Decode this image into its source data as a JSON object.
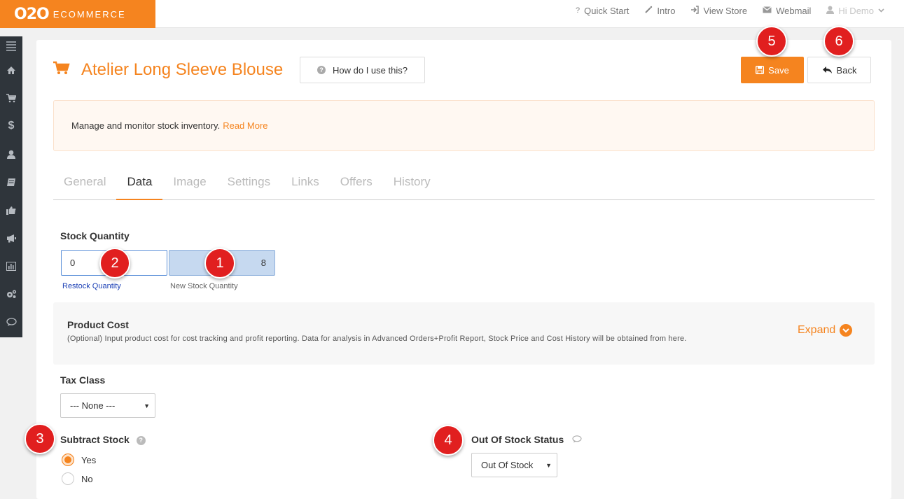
{
  "brand": {
    "mark": "O2O",
    "text": "ECOMMERCE"
  },
  "topnav": {
    "quick_start": "Quick Start",
    "intro": "Intro",
    "view_store": "View Store",
    "webmail": "Webmail",
    "user": "Hi Demo"
  },
  "sidebar": {
    "items": [
      "menu-icon",
      "home-icon",
      "cart-icon",
      "dollar-icon",
      "user-icon",
      "book-icon",
      "thumbs-up-icon",
      "megaphone-icon",
      "chart-icon",
      "gears-icon",
      "comment-icon"
    ]
  },
  "header": {
    "title": "Atelier Long Sleeve Blouse",
    "help_label": "How do I use this?",
    "save_label": "Save",
    "back_label": "Back"
  },
  "info": {
    "text": "Manage and monitor stock inventory.",
    "link": "Read More"
  },
  "tabs": [
    "General",
    "Data",
    "Image",
    "Settings",
    "Links",
    "Offers",
    "History"
  ],
  "active_tab": "Data",
  "stock": {
    "label": "Stock Quantity",
    "restock_value": "0",
    "restock_caption": "Restock Quantity",
    "new_value": "8",
    "new_caption": "New Stock Quantity"
  },
  "cost": {
    "title": "Product Cost",
    "description": "(Optional) Input product cost for cost tracking and profit reporting. Data for analysis in Advanced Orders+Profit Report, Stock Price and Cost History will be obtained from here.",
    "expand_label": "Expand"
  },
  "tax": {
    "label": "Tax Class",
    "selected": "--- None ---"
  },
  "subtract": {
    "label": "Subtract Stock",
    "options": [
      "Yes",
      "No"
    ],
    "selected": "Yes"
  },
  "out_of_stock": {
    "label": "Out Of Stock Status",
    "selected": "Out Of Stock"
  },
  "badges": [
    "1",
    "2",
    "3",
    "4",
    "5",
    "6"
  ],
  "colors": {
    "accent": "#f5841f",
    "badge": "#e11f1f",
    "sidebar": "#2f353b"
  }
}
